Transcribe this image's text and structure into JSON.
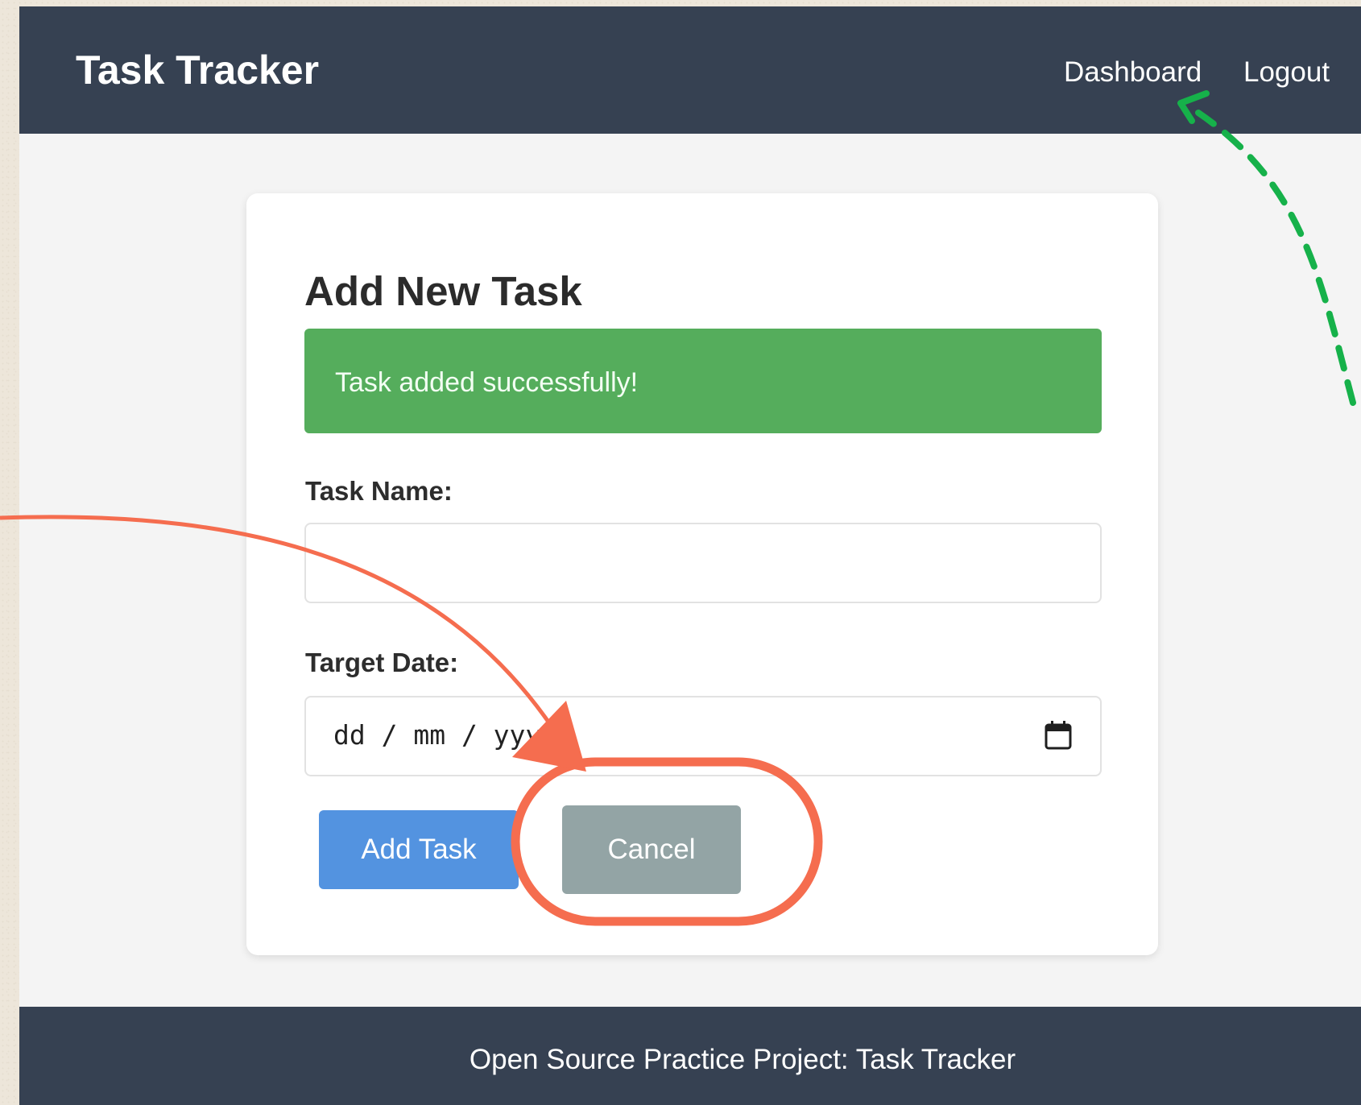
{
  "navbar": {
    "brand": "Task Tracker",
    "links": [
      {
        "label": "Dashboard"
      },
      {
        "label": "Logout"
      }
    ]
  },
  "form": {
    "title": "Add New Task",
    "alert": "Task added successfully!",
    "task_name_label": "Task Name:",
    "task_name_value": "",
    "target_date_label": "Target Date:",
    "target_date_placeholder": "dd / mm / yyyy",
    "add_button": "Add Task",
    "cancel_button": "Cancel"
  },
  "footer": {
    "text": "Open Source Practice Project: Task Tracker"
  },
  "colors": {
    "navbar": "#364152",
    "alert_success": "#55ad5c",
    "primary_button": "#5393e0",
    "cancel_button": "#93a4a5",
    "highlight_annotation": "#f56d4f",
    "arrow_annotation_green": "#16b14a"
  }
}
